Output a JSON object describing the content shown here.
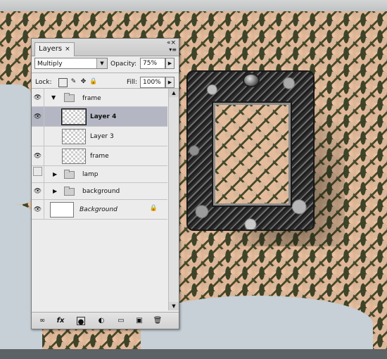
{
  "panel": {
    "tab_label": "Layers",
    "tab_close": "×",
    "panel_close": "«×",
    "panel_menu": "▾≡",
    "blend_mode": "Multiply",
    "opacity_label": "Opacity:",
    "opacity_value": "75%",
    "lock_label": "Lock:",
    "fill_label": "Fill:",
    "fill_value": "100%"
  },
  "layers": [
    {
      "name": "frame",
      "kind": "group",
      "expanded": true,
      "visible": true
    },
    {
      "name": "Layer 4",
      "kind": "layer",
      "visible": true,
      "selected": true
    },
    {
      "name": "Layer 3",
      "kind": "layer",
      "visible": false
    },
    {
      "name": "frame",
      "kind": "layer",
      "visible": true
    },
    {
      "name": "lamp",
      "kind": "group",
      "expanded": false,
      "visible": false
    },
    {
      "name": "background",
      "kind": "group",
      "expanded": false,
      "visible": true
    },
    {
      "name": "Background",
      "kind": "background",
      "visible": true,
      "locked": true
    }
  ],
  "footer_icons": [
    "link-icon",
    "fx-icon",
    "mask-icon",
    "adjustment-icon",
    "group-icon",
    "new-layer-icon",
    "trash-icon"
  ],
  "footer_labels": {
    "fx": "fx"
  },
  "colors": {
    "selection": "#b4b7c3",
    "panel": "#ececec",
    "wallpaper_light": "#e4bc9c",
    "wallpaper_dark": "#454a2c"
  }
}
